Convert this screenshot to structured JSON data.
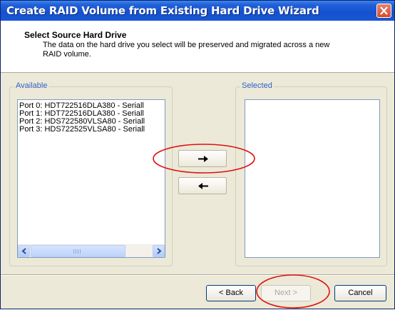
{
  "window": {
    "title": "Create RAID Volume from Existing Hard Drive Wizard"
  },
  "header": {
    "title": "Select Source Hard Drive",
    "description": "The data on the hard drive you select will be preserved and migrated across a new RAID volume."
  },
  "available": {
    "label": "Available",
    "items": [
      "Port 0: HDT722516DLA380 - Seriall",
      "Port 1: HDT722516DLA380 - Seriall",
      "Port 2: HDS722580VLSA80 - Seriall",
      "Port 3: HDS722525VLSA80 - Seriall"
    ]
  },
  "selected": {
    "label": "Selected",
    "items": []
  },
  "move": {
    "add_icon": "arrow-right-icon",
    "remove_icon": "arrow-left-icon"
  },
  "buttons": {
    "back": "< Back",
    "next": "Next >",
    "cancel": "Cancel"
  },
  "colors": {
    "title_bar": "#1451d0",
    "annotation_circle": "#e01010",
    "group_label": "#3060c8"
  }
}
